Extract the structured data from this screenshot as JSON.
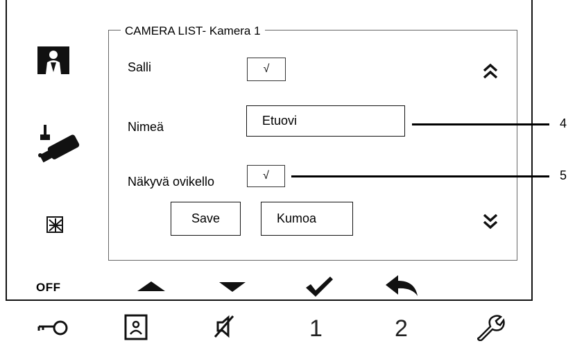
{
  "panel": {
    "title": "CAMERA LIST- Kamera 1",
    "allow_label": "Salli",
    "allow_value": "√",
    "name_label": "Nimeä",
    "name_value": "Etuovi",
    "visible_label": "Näkyvä ovikello",
    "visible_value": "√",
    "save_label": "Save",
    "cancel_label": "Kumoa"
  },
  "callouts": {
    "name": "4",
    "visible": "5"
  },
  "sidebar": {
    "off_label": "OFF",
    "icons": [
      "person-monitor-icon",
      "security-camera-icon",
      "do-not-disturb-icon"
    ]
  },
  "scroll": {
    "up_icon": "double-chevron-up-icon",
    "down_icon": "double-chevron-down-icon"
  },
  "navbar": {
    "icons": [
      "triangle-up-icon",
      "triangle-down-icon",
      "checkmark-icon",
      "back-arrow-icon"
    ]
  },
  "hardware_buttons": {
    "key_icon": "key-icon",
    "monitor_icon": "monitor-icon",
    "mute_icon": "mute-icon",
    "button1_label": "1",
    "button2_label": "2",
    "wrench_icon": "wrench-icon"
  }
}
